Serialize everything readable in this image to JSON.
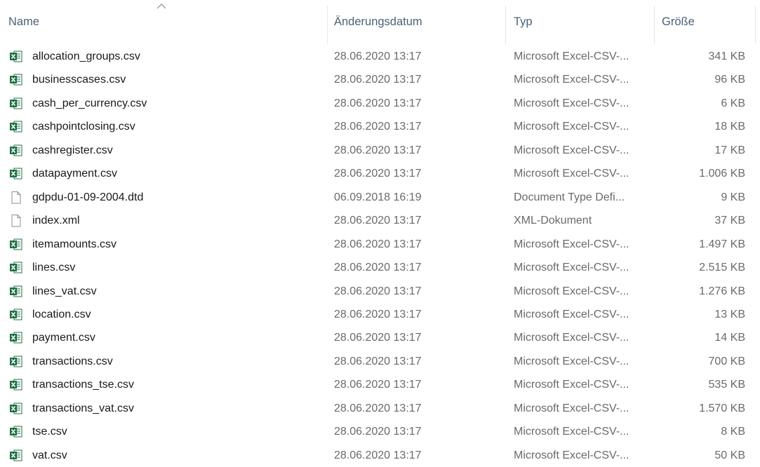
{
  "columns": {
    "name": "Name",
    "date": "Änderungsdatum",
    "type": "Typ",
    "size": "Größe"
  },
  "files": [
    {
      "name": "allocation_groups.csv",
      "date": "28.06.2020 13:17",
      "type": "Microsoft Excel-CSV-...",
      "size": "341 KB",
      "icon": "excel-csv-icon"
    },
    {
      "name": "businesscases.csv",
      "date": "28.06.2020 13:17",
      "type": "Microsoft Excel-CSV-...",
      "size": "96 KB",
      "icon": "excel-csv-icon"
    },
    {
      "name": "cash_per_currency.csv",
      "date": "28.06.2020 13:17",
      "type": "Microsoft Excel-CSV-...",
      "size": "6 KB",
      "icon": "excel-csv-icon"
    },
    {
      "name": "cashpointclosing.csv",
      "date": "28.06.2020 13:17",
      "type": "Microsoft Excel-CSV-...",
      "size": "18 KB",
      "icon": "excel-csv-icon"
    },
    {
      "name": "cashregister.csv",
      "date": "28.06.2020 13:17",
      "type": "Microsoft Excel-CSV-...",
      "size": "17 KB",
      "icon": "excel-csv-icon"
    },
    {
      "name": "datapayment.csv",
      "date": "28.06.2020 13:17",
      "type": "Microsoft Excel-CSV-...",
      "size": "1.006 KB",
      "icon": "excel-csv-icon"
    },
    {
      "name": "gdpdu-01-09-2004.dtd",
      "date": "06.09.2018 16:19",
      "type": "Document Type Defi...",
      "size": "9 KB",
      "icon": "blank-file-icon"
    },
    {
      "name": "index.xml",
      "date": "28.06.2020 13:17",
      "type": "XML-Dokument",
      "size": "37 KB",
      "icon": "blank-file-icon"
    },
    {
      "name": "itemamounts.csv",
      "date": "28.06.2020 13:17",
      "type": "Microsoft Excel-CSV-...",
      "size": "1.497 KB",
      "icon": "excel-csv-icon"
    },
    {
      "name": "lines.csv",
      "date": "28.06.2020 13:17",
      "type": "Microsoft Excel-CSV-...",
      "size": "2.515 KB",
      "icon": "excel-csv-icon"
    },
    {
      "name": "lines_vat.csv",
      "date": "28.06.2020 13:17",
      "type": "Microsoft Excel-CSV-...",
      "size": "1.276 KB",
      "icon": "excel-csv-icon"
    },
    {
      "name": "location.csv",
      "date": "28.06.2020 13:17",
      "type": "Microsoft Excel-CSV-...",
      "size": "13 KB",
      "icon": "excel-csv-icon"
    },
    {
      "name": "payment.csv",
      "date": "28.06.2020 13:17",
      "type": "Microsoft Excel-CSV-...",
      "size": "14 KB",
      "icon": "excel-csv-icon"
    },
    {
      "name": "transactions.csv",
      "date": "28.06.2020 13:17",
      "type": "Microsoft Excel-CSV-...",
      "size": "700 KB",
      "icon": "excel-csv-icon"
    },
    {
      "name": "transactions_tse.csv",
      "date": "28.06.2020 13:17",
      "type": "Microsoft Excel-CSV-...",
      "size": "535 KB",
      "icon": "excel-csv-icon"
    },
    {
      "name": "transactions_vat.csv",
      "date": "28.06.2020 13:17",
      "type": "Microsoft Excel-CSV-...",
      "size": "1.570 KB",
      "icon": "excel-csv-icon"
    },
    {
      "name": "tse.csv",
      "date": "28.06.2020 13:17",
      "type": "Microsoft Excel-CSV-...",
      "size": "8 KB",
      "icon": "excel-csv-icon"
    },
    {
      "name": "vat.csv",
      "date": "28.06.2020 13:17",
      "type": "Microsoft Excel-CSV-...",
      "size": "50 KB",
      "icon": "excel-csv-icon"
    }
  ],
  "colors": {
    "header_text": "#4c607a",
    "secondary_text": "#6a6a6a",
    "excel_green": "#1d7044"
  }
}
